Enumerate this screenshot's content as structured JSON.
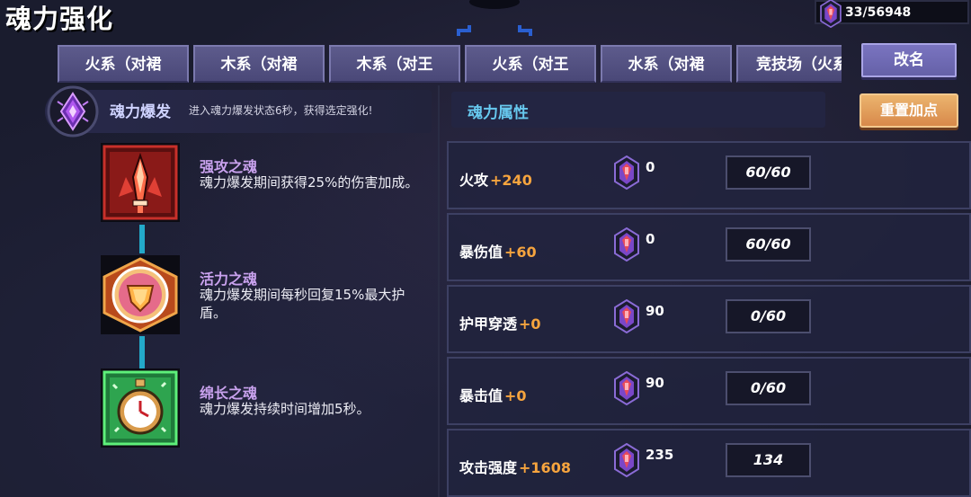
{
  "header": {
    "title": "魂力强化",
    "currency": {
      "icon": "soul-gem-icon",
      "text": "33/56948"
    }
  },
  "tabs": [
    {
      "label": "火系（对裙"
    },
    {
      "label": "木系（对裙"
    },
    {
      "label": "木系（对王"
    },
    {
      "label": "火系（对王"
    },
    {
      "label": "水系（对裙"
    },
    {
      "label": "竞技场（火系"
    }
  ],
  "rename_label": "改名",
  "soul_burst": {
    "title": "魂力爆发",
    "description": "进入魂力爆发状态6秒，获得选定强化!"
  },
  "souls": [
    {
      "name": "强攻之魂",
      "description": "魂力爆发期间获得25%的伤害加成。",
      "icon": "sword-soul-icon"
    },
    {
      "name": "活力之魂",
      "description": "魂力爆发期间每秒回复15%最大护盾。",
      "icon": "shield-soul-icon"
    },
    {
      "name": "绵长之魂",
      "description": "魂力爆发持续时间增加5秒。",
      "icon": "stopwatch-soul-icon"
    }
  ],
  "attributes": {
    "title": "魂力属性",
    "reset_label": "重置加点",
    "rows": [
      {
        "name": "火攻",
        "bonus": "+240",
        "cost": "0",
        "level": "60/60"
      },
      {
        "name": "暴伤值",
        "bonus": "+60",
        "cost": "0",
        "level": "60/60"
      },
      {
        "name": "护甲穿透",
        "bonus": "+0",
        "cost": "90",
        "level": "0/60"
      },
      {
        "name": "暴击值",
        "bonus": "+0",
        "cost": "90",
        "level": "0/60"
      },
      {
        "name": "攻击强度",
        "bonus": "+1608",
        "cost": "235",
        "level": "134"
      }
    ]
  },
  "colors": {
    "background": "#1a1c2e",
    "tab": "#4a4878",
    "accent_cyan": "#67c9ef",
    "bonus_orange": "#f6a43e",
    "soul_name": "#c9a2ee",
    "reset_button": "#d8894a"
  }
}
